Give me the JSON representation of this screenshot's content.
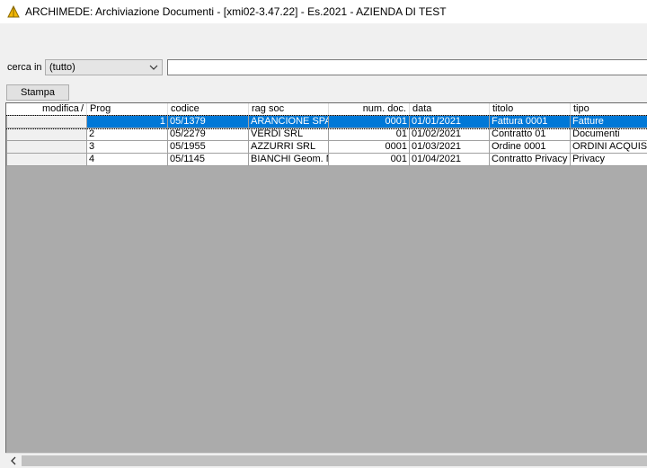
{
  "window": {
    "title": "ARCHIMEDE: Archiviazione Documenti - [xmi02-3.47.22] - Es.2021 - AZIENDA DI TEST"
  },
  "search": {
    "label": "cerca in",
    "scope_value": "(tutto)",
    "query_value": ""
  },
  "toolbar": {
    "stampa_label": "Stampa"
  },
  "grid": {
    "columns": [
      "modifica",
      "Prog",
      "codice",
      "rag soc",
      "num. doc.",
      "data",
      "titolo",
      "tipo"
    ],
    "sort_indicator": "/",
    "rows": [
      {
        "prog": "1",
        "codice": "05/1379",
        "rag_soc": "ARANCIONE SPA",
        "num_doc": "0001",
        "data": "01/01/2021",
        "titolo": "Fattura 0001",
        "tipo": "Fatture",
        "selected": true
      },
      {
        "prog": "2",
        "codice": "05/2279",
        "rag_soc": "VERDI SRL",
        "num_doc": "01",
        "data": "01/02/2021",
        "titolo": "Contratto 01",
        "tipo": "Documenti"
      },
      {
        "prog": "3",
        "codice": "05/1955",
        "rag_soc": "AZZURRI SRL",
        "num_doc": "0001",
        "data": "01/03/2021",
        "titolo": "Ordine 0001",
        "tipo": "ORDINI ACQUIST"
      },
      {
        "prog": "4",
        "codice": "05/1145",
        "rag_soc": "BIANCHI Geom. M",
        "num_doc": "001",
        "data": "01/04/2021",
        "titolo": "Contratto Privacy",
        "tipo": "Privacy"
      }
    ]
  },
  "icons": {
    "app": "archimede-app-icon",
    "combo": "chevron-down-icon",
    "scroll_left": "chevron-left-icon"
  },
  "colors": {
    "selection": "#0078d7",
    "grid_background": "#ababab"
  }
}
